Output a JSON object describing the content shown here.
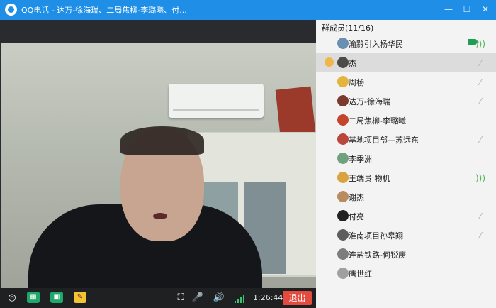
{
  "titlebar": {
    "title": "QQ电话 - 达万-徐海瑞、二局焦柳-李璐曦、付..."
  },
  "members_panel": {
    "heading": "群成员(11/16)",
    "items": [
      {
        "name": "渝黔引入杨华民",
        "status": "camera+speaking",
        "selected": false
      },
      {
        "name": "杰",
        "status": "muted",
        "selected": true,
        "host": true
      },
      {
        "name": "周杨",
        "status": "muted",
        "selected": false
      },
      {
        "name": "达万-徐海瑞",
        "status": "muted",
        "selected": false
      },
      {
        "name": "二局焦柳-李璐曦",
        "status": "none",
        "selected": false
      },
      {
        "name": "基地项目部—苏远东",
        "status": "muted",
        "selected": false
      },
      {
        "name": "李季洲",
        "status": "none",
        "selected": false
      },
      {
        "name": "王端贵 物机",
        "status": "speaking",
        "selected": false
      },
      {
        "name": "谢杰",
        "status": "none",
        "selected": false
      },
      {
        "name": "付亮",
        "status": "muted",
        "selected": false
      },
      {
        "name": "淮南项目孙皋翔",
        "status": "muted",
        "selected": false
      },
      {
        "name": "连盐铁路-何锐庚",
        "status": "none",
        "selected": false
      },
      {
        "name": "唐世红",
        "status": "none",
        "selected": false
      }
    ]
  },
  "controls": {
    "timer": "1:26:44",
    "exit_label": "退出"
  },
  "icons": {
    "logo": "qq-logo-icon",
    "fullscreen": "fullscreen-icon",
    "mic": "mic-off-icon",
    "speaker": "speaker-icon",
    "signal": "signal-strength-icon"
  },
  "colors": {
    "titlebar": "#1e8ee6",
    "exit": "#e44a3d",
    "speaking": "#4bb857"
  }
}
